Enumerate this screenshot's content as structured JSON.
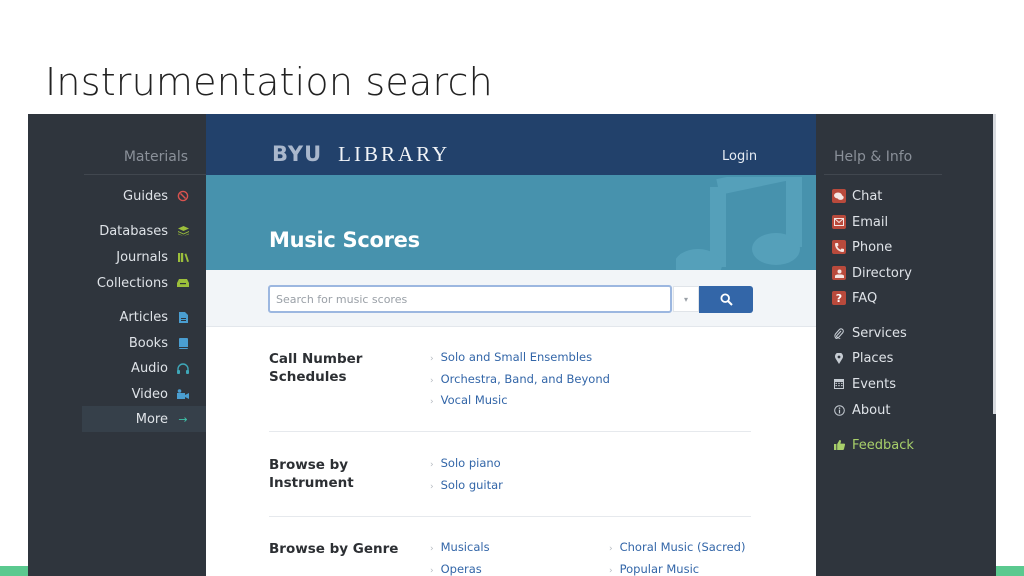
{
  "slide": {
    "title": "Instrumentation search",
    "accent_color": "#5bc98f"
  },
  "left_nav": {
    "heading": "Materials",
    "items": [
      {
        "label": "Guides",
        "icon": "compass-icon",
        "glyph": "⊘",
        "color": "#d9534f"
      },
      {
        "label": "Databases",
        "icon": "layers-icon",
        "glyph": "≋",
        "color": "#9cbf3b"
      },
      {
        "label": "Journals",
        "icon": "books-icon",
        "glyph": "▥",
        "color": "#9cbf3b"
      },
      {
        "label": "Collections",
        "icon": "drawer-icon",
        "glyph": "⏏",
        "color": "#9cbf3b"
      },
      {
        "label": "Articles",
        "icon": "document-icon",
        "glyph": "▤",
        "color": "#4a9ed1"
      },
      {
        "label": "Books",
        "icon": "book-icon",
        "glyph": "▮",
        "color": "#4a9ed1"
      },
      {
        "label": "Audio",
        "icon": "headphones-icon",
        "glyph": "∩",
        "color": "#3ea7b8"
      },
      {
        "label": "Video",
        "icon": "video-camera-icon",
        "glyph": "▶",
        "color": "#4a9ed1"
      },
      {
        "label": "More",
        "icon": "arrow-right-icon",
        "glyph": "→",
        "color": "#3ec0a8",
        "active": true
      }
    ]
  },
  "header": {
    "logo_byu": "BYU",
    "logo_library": "LIBRARY",
    "login_label": "Login",
    "bar_color": "#22416b"
  },
  "hero": {
    "title": "Music Scores",
    "color": "#4792ad"
  },
  "search": {
    "placeholder": "Search for music scores",
    "value": "",
    "dropdown_glyph": "▾",
    "button_icon": "search-icon",
    "button_color": "#3366a8"
  },
  "sections": [
    {
      "label": "Call Number Schedules",
      "links": [
        "Solo and Small Ensembles",
        "Orchestra, Band, and Beyond",
        "Vocal Music"
      ],
      "links_col2": []
    },
    {
      "label": "Browse by Instrument",
      "links": [
        "Solo piano",
        "Solo guitar"
      ],
      "links_col2": []
    },
    {
      "label": "Browse by Genre",
      "links": [
        "Musicals",
        "Operas"
      ],
      "links_col2": [
        "Choral Music (Sacred)",
        "Popular Music"
      ]
    }
  ],
  "link_chevron": "›",
  "right_nav": {
    "heading": "Help & Info",
    "items": [
      {
        "label": "Chat",
        "icon": "chat-bubbles-icon",
        "glyph": "💬",
        "style": "red"
      },
      {
        "label": "Email",
        "icon": "envelope-icon",
        "glyph": "✉",
        "style": "red"
      },
      {
        "label": "Phone",
        "icon": "phone-icon",
        "glyph": "✆",
        "style": "red"
      },
      {
        "label": "Directory",
        "icon": "person-directory-icon",
        "glyph": "☗",
        "style": "red"
      },
      {
        "label": "FAQ",
        "icon": "question-icon",
        "glyph": "?",
        "style": "red"
      },
      {
        "label": "Services",
        "icon": "paperclip-icon",
        "glyph": "⌇",
        "style": "plain"
      },
      {
        "label": "Places",
        "icon": "map-pin-icon",
        "glyph": "⚲",
        "style": "plain"
      },
      {
        "label": "Events",
        "icon": "calendar-icon",
        "glyph": "▦",
        "style": "plain"
      },
      {
        "label": "About",
        "icon": "info-icon",
        "glyph": "ⓘ",
        "style": "plain"
      },
      {
        "label": "Feedback",
        "icon": "thumbs-up-icon",
        "glyph": "👍",
        "style": "feedback"
      }
    ]
  }
}
